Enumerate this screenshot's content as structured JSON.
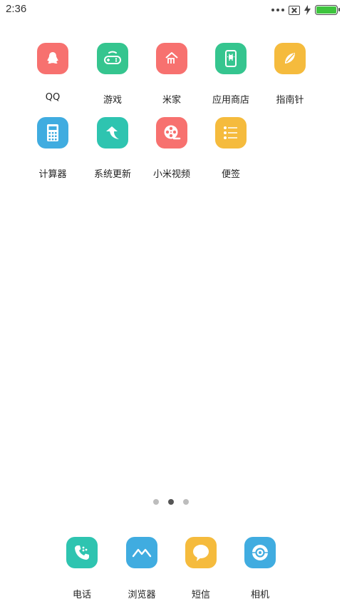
{
  "status": {
    "time": "2:36",
    "battery_level": 1.0,
    "colors": {
      "battery": "#3ec43e"
    }
  },
  "apps": [
    {
      "label": "QQ",
      "icon": "penguin-icon",
      "color": "#f7716f"
    },
    {
      "label": "游戏",
      "icon": "gamepad-icon",
      "color": "#35c58f"
    },
    {
      "label": "米家",
      "icon": "mi-home-icon",
      "color": "#f7716f"
    },
    {
      "label": "应用商店",
      "icon": "app-store-icon",
      "color": "#35c58f"
    },
    {
      "label": "指南针",
      "icon": "compass-icon",
      "color": "#f5bb3d"
    },
    {
      "label": "计算器",
      "icon": "calculator-icon",
      "color": "#40ace0"
    },
    {
      "label": "系统更新",
      "icon": "update-arrow-icon",
      "color": "#2ec4b0"
    },
    {
      "label": "小米视频",
      "icon": "film-reel-icon",
      "color": "#f7716f"
    },
    {
      "label": "便签",
      "icon": "notes-list-icon",
      "color": "#f5bb3d"
    }
  ],
  "pager": {
    "count": 3,
    "active_index": 1
  },
  "dock": [
    {
      "label": "电话",
      "icon": "phone-icon",
      "color": "#2ec4b0"
    },
    {
      "label": "浏览器",
      "icon": "browser-icon",
      "color": "#40ace0"
    },
    {
      "label": "短信",
      "icon": "message-icon",
      "color": "#f5bb3d"
    },
    {
      "label": "相机",
      "icon": "camera-icon",
      "color": "#40ace0"
    }
  ]
}
